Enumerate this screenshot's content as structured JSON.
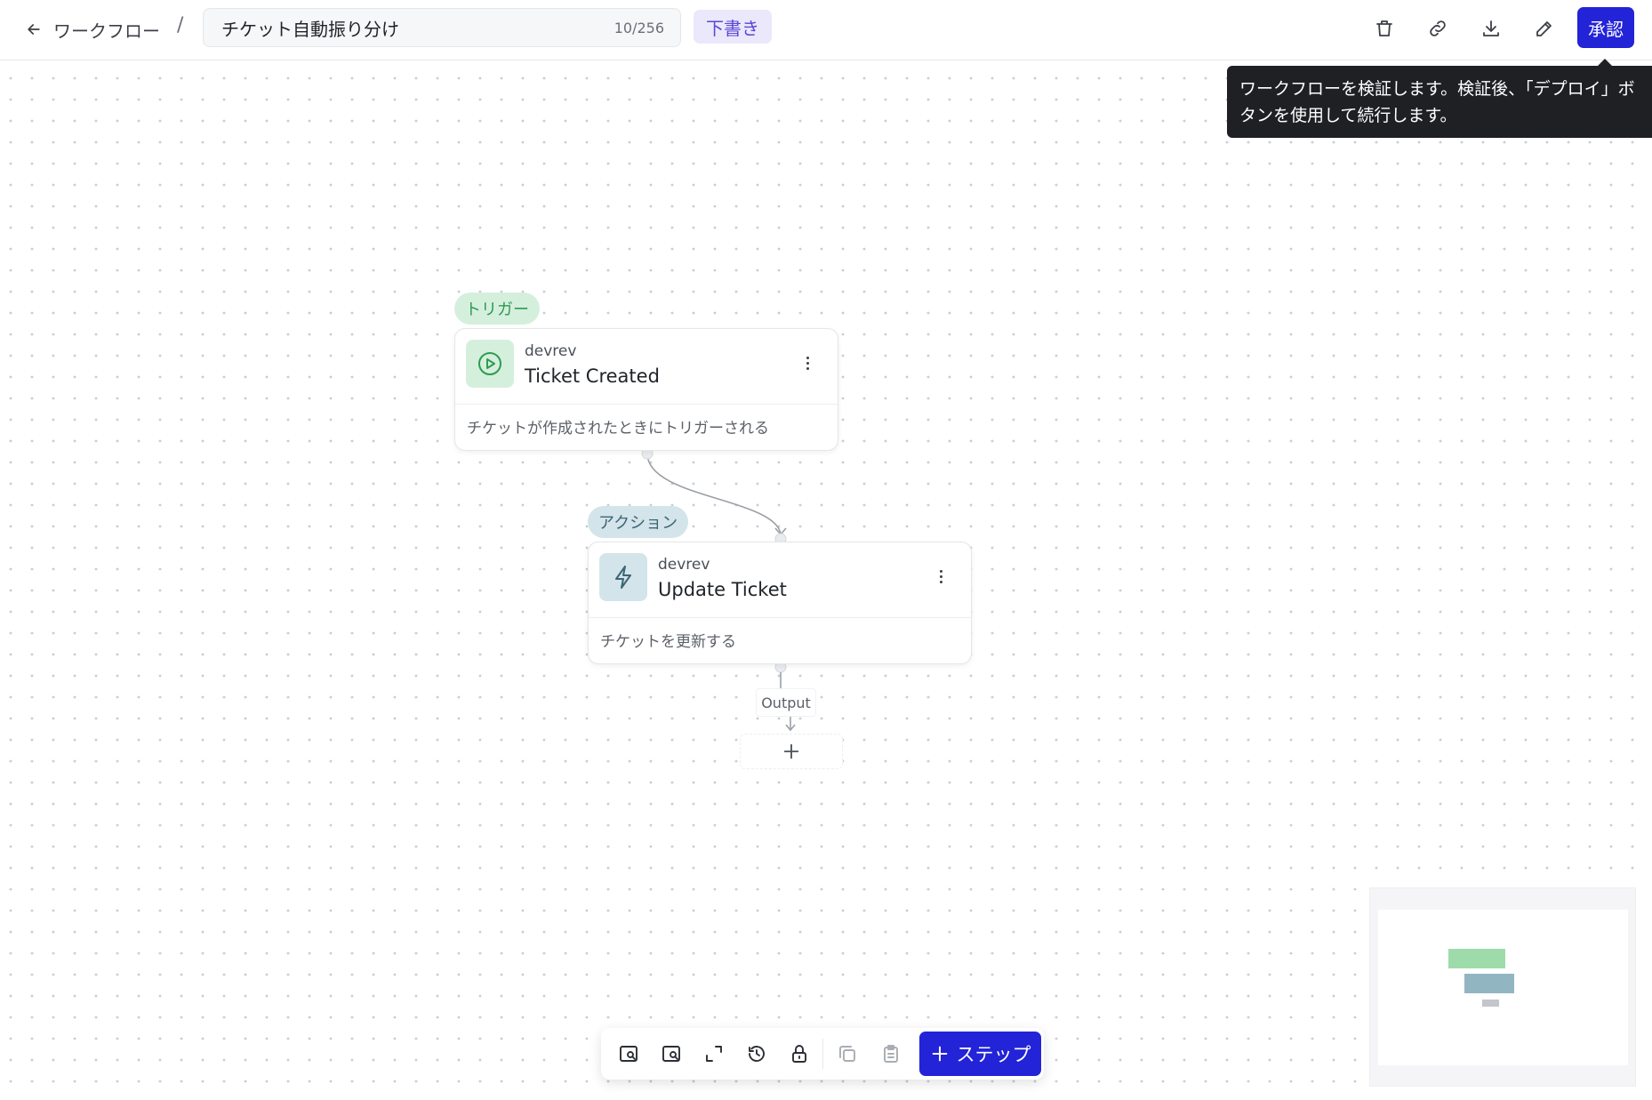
{
  "header": {
    "back_label": "ワークフロー",
    "separator": "/",
    "workflow_name": "チケット自動振り分け",
    "char_count": "10/256",
    "status_badge": "下書き",
    "approve_label": "承認",
    "tools": [
      "trash-icon",
      "link-icon",
      "download-icon",
      "edit-icon"
    ]
  },
  "tooltip": {
    "text_line1": "ワークフローを検証します。検証後、「デプロイ」ボ",
    "text_line2": "タンを使用して続行します。"
  },
  "nodes": [
    {
      "tag": "トリガー",
      "provider": "devrev",
      "name": "Ticket Created",
      "description": "チケットが作成されたときにトリガーされる",
      "icon": "play-circle-icon",
      "color": "#2f9a52"
    },
    {
      "tag": "アクション",
      "provider": "devrev",
      "name": "Update Ticket",
      "description": "チケットを更新する",
      "icon": "lightning-icon",
      "color": "#3d6575"
    }
  ],
  "output_label": "Output",
  "toolbar": {
    "buttons": [
      "zoom-in-icon",
      "zoom-out-icon",
      "fit-view-icon",
      "history-icon",
      "lock-icon",
      "copy-icon",
      "clipboard-icon"
    ],
    "add_step_label": "ステップ"
  },
  "colors": {
    "primary": "#2323d8",
    "trigger_bg": "#d5efdd",
    "action_bg": "#d3e4ea",
    "draft_bg": "#ebe8fb",
    "draft_fg": "#5a48d6"
  }
}
